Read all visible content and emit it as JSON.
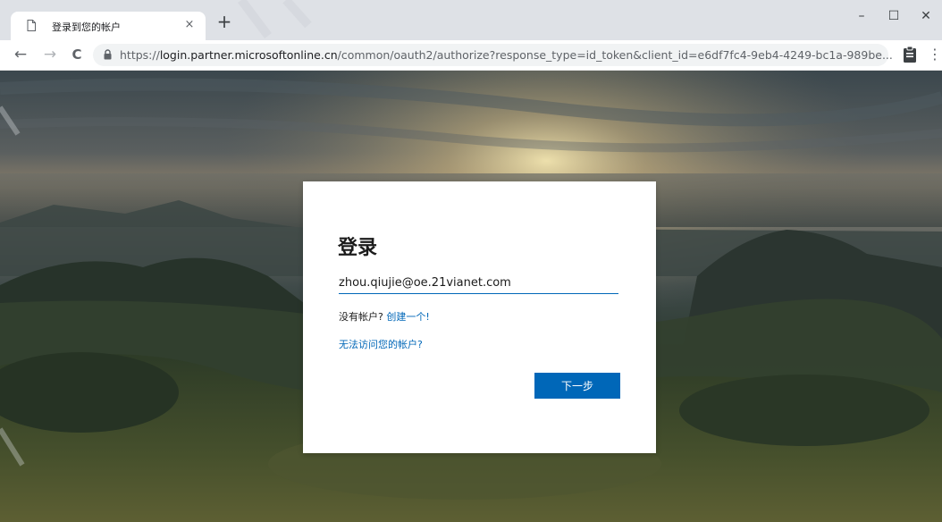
{
  "browser": {
    "tab": {
      "title": "登录到您的帐户",
      "favicon": "page-icon",
      "close_glyph": "×"
    },
    "new_tab_glyph": "+",
    "window_controls": {
      "minimize": "–",
      "maximize": "☐",
      "close": "✕"
    },
    "nav": {
      "back": "←",
      "forward": "→",
      "reload": "C"
    },
    "address": {
      "scheme": "https://",
      "host": "login.partner.microsoftonline.cn",
      "path": "/common/oauth2/authorize?response_type=id_token&client_id=e6df7fc4-9eb4-4249-bc1a-989be..."
    },
    "menu_glyph": "⋮"
  },
  "signin": {
    "title": "登录",
    "email_value": "zhou.qiujie@oe.21vianet.com",
    "no_account_text": "没有帐户?",
    "create_link": "创建一个!",
    "cant_access_link": "无法访问您的帐户?",
    "next_label": "下一步"
  },
  "colors": {
    "accent": "#0067b8",
    "tabstrip": "#dee1e6"
  }
}
